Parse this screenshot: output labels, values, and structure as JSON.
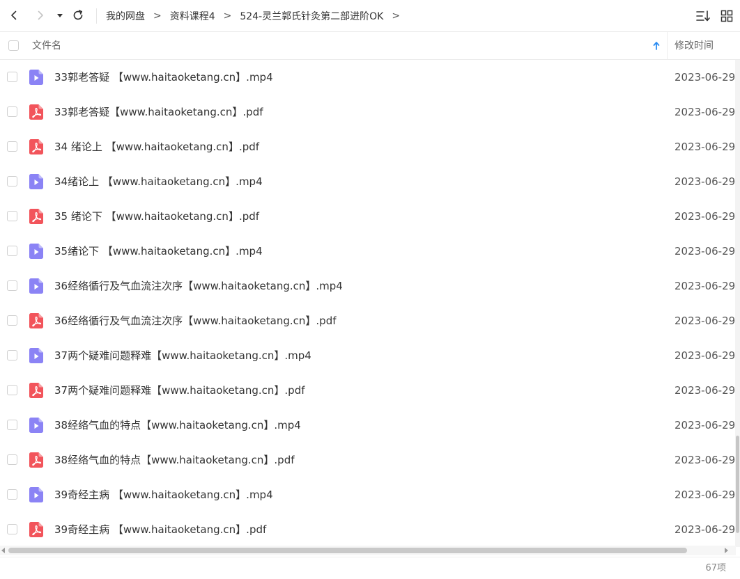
{
  "breadcrumb": [
    "我的网盘",
    "资料课程4",
    "524-灵兰郭氏针灸第二部进阶OK"
  ],
  "header": {
    "name_label": "文件名",
    "time_label": "修改时间"
  },
  "files": [
    {
      "type": "video",
      "name": "33郭老答疑 【www.haitaoketang.cn】.mp4",
      "time": "2023-06-29"
    },
    {
      "type": "pdf",
      "name": "33郭老答疑【www.haitaoketang.cn】.pdf",
      "time": "2023-06-29"
    },
    {
      "type": "pdf",
      "name": "34 绪论上 【www.haitaoketang.cn】.pdf",
      "time": "2023-06-29"
    },
    {
      "type": "video",
      "name": "34绪论上 【www.haitaoketang.cn】.mp4",
      "time": "2023-06-29"
    },
    {
      "type": "pdf",
      "name": "35 绪论下 【www.haitaoketang.cn】.pdf",
      "time": "2023-06-29"
    },
    {
      "type": "video",
      "name": "35绪论下 【www.haitaoketang.cn】.mp4",
      "time": "2023-06-29"
    },
    {
      "type": "video",
      "name": "36经络循行及气血流注次序【www.haitaoketang.cn】.mp4",
      "time": "2023-06-29"
    },
    {
      "type": "pdf",
      "name": "36经络循行及气血流注次序【www.haitaoketang.cn】.pdf",
      "time": "2023-06-29"
    },
    {
      "type": "video",
      "name": "37两个疑难问题释难【www.haitaoketang.cn】.mp4",
      "time": "2023-06-29"
    },
    {
      "type": "pdf",
      "name": "37两个疑难问题释难【www.haitaoketang.cn】.pdf",
      "time": "2023-06-29"
    },
    {
      "type": "video",
      "name": "38经络气血的特点【www.haitaoketang.cn】.mp4",
      "time": "2023-06-29"
    },
    {
      "type": "pdf",
      "name": "38经络气血的特点【www.haitaoketang.cn】.pdf",
      "time": "2023-06-29"
    },
    {
      "type": "video",
      "name": "39奇经主病 【www.haitaoketang.cn】.mp4",
      "time": "2023-06-29"
    },
    {
      "type": "pdf",
      "name": "39奇经主病 【www.haitaoketang.cn】.pdf",
      "time": "2023-06-29"
    }
  ],
  "status": {
    "item_count": "67项"
  },
  "colors": {
    "video_icon": "#8b83f5",
    "pdf_icon": "#f2545b",
    "sort_arrow": "#2b8cf2"
  },
  "icons": {
    "back": "chevron-left-icon",
    "forward": "chevron-right-icon",
    "dropdown": "caret-down-icon",
    "refresh": "refresh-icon",
    "sort": "sort-list-icon",
    "grid": "grid-view-icon",
    "video": "video-file-icon",
    "pdf": "pdf-file-icon"
  }
}
